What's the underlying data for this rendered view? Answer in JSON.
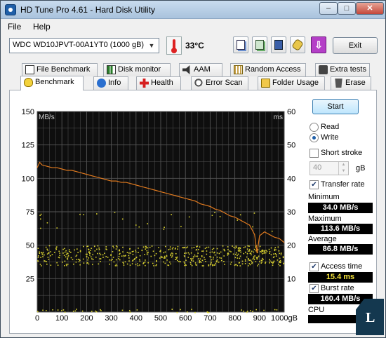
{
  "window": {
    "title": "HD Tune Pro 4.61 - Hard Disk Utility"
  },
  "menu": {
    "file": "File",
    "help": "Help"
  },
  "toolbar": {
    "drive": "WDC WD10JPVT-00A1YT0 (1000 gB)",
    "temperature": "33°C",
    "exit_label": "Exit",
    "download_icon": "⇩"
  },
  "tabs_row1": [
    {
      "label": "File Benchmark",
      "icon": "document-icon"
    },
    {
      "label": "Disk monitor",
      "icon": "chart-icon"
    },
    {
      "label": "AAM",
      "icon": "speaker-icon"
    },
    {
      "label": "Random Access",
      "icon": "grid-icon"
    },
    {
      "label": "Extra tests",
      "icon": "tools-icon"
    }
  ],
  "tabs_row2": [
    {
      "label": "Benchmark",
      "icon": "bulb-icon",
      "active": true
    },
    {
      "label": "Info",
      "icon": "info-icon"
    },
    {
      "label": "Health",
      "icon": "health-icon"
    },
    {
      "label": "Error Scan",
      "icon": "scan-icon"
    },
    {
      "label": "Folder Usage",
      "icon": "folder-icon"
    },
    {
      "label": "Erase",
      "icon": "trash-icon"
    }
  ],
  "controls": {
    "start_label": "Start",
    "read_label": "Read",
    "write_label": "Write",
    "mode_selected": "Write",
    "short_stroke_label": "Short stroke",
    "short_stroke_checked": false,
    "short_stroke_value": "40",
    "short_stroke_unit": "gB",
    "transfer_rate_label": "Transfer rate",
    "transfer_rate_checked": true,
    "minimum_label": "Minimum",
    "minimum_value": "34.0 MB/s",
    "maximum_label": "Maximum",
    "maximum_value": "113.6 MB/s",
    "average_label": "Average",
    "average_value": "86.8 MB/s",
    "access_time_label": "Access time",
    "access_time_checked": true,
    "access_time_value": "15.4 ms",
    "burst_rate_label": "Burst rate",
    "burst_rate_checked": true,
    "burst_rate_value": "160.4 MB/s",
    "cpu_label": "CPU"
  },
  "chart_data": {
    "type": "line",
    "left_axis_unit": "MB/s",
    "right_axis_unit": "ms",
    "x_ticks": [
      "0",
      "100",
      "200",
      "300",
      "400",
      "500",
      "600",
      "700",
      "800",
      "900",
      "1000gB"
    ],
    "y_left_ticks": [
      "150",
      "125",
      "100",
      "75",
      "50",
      "25"
    ],
    "y_right_ticks": [
      "60",
      "50",
      "40",
      "30",
      "20",
      "10"
    ],
    "xlim": [
      0,
      1000
    ],
    "ylim_left": [
      0,
      150
    ],
    "ylim_right": [
      0,
      60
    ],
    "grid": true,
    "colors": {
      "background": "#0e0e0e",
      "grid": "#555555",
      "transfer": "#e07a1f",
      "access": "#d8d02e"
    },
    "series": [
      {
        "name": "Transfer rate",
        "axis": "left",
        "x": [
          0,
          10,
          20,
          40,
          60,
          80,
          100,
          120,
          140,
          160,
          180,
          200,
          220,
          240,
          260,
          280,
          300,
          320,
          340,
          360,
          380,
          400,
          420,
          440,
          460,
          480,
          500,
          520,
          540,
          560,
          580,
          600,
          620,
          640,
          660,
          680,
          700,
          720,
          740,
          760,
          780,
          800,
          820,
          840,
          860,
          880,
          890,
          900,
          920,
          940,
          960,
          980,
          1000
        ],
        "y": [
          108,
          112,
          110,
          109,
          108,
          108,
          107,
          106,
          106,
          105,
          104,
          103,
          102,
          101,
          100,
          99,
          98,
          98,
          97,
          97,
          96,
          95,
          94,
          93,
          92,
          91,
          90,
          89,
          88,
          87,
          86,
          85,
          84,
          83,
          81,
          80,
          79,
          77,
          76,
          74,
          72,
          71,
          69,
          67,
          65,
          58,
          44,
          57,
          60,
          58,
          56,
          55,
          52
        ]
      },
      {
        "name": "Access time",
        "axis": "right",
        "display": "scatter",
        "y_band": [
          14,
          20
        ],
        "y_mean": 15.4,
        "outlier_band": [
          24,
          30
        ],
        "floor_band": [
          0,
          1
        ]
      }
    ]
  }
}
